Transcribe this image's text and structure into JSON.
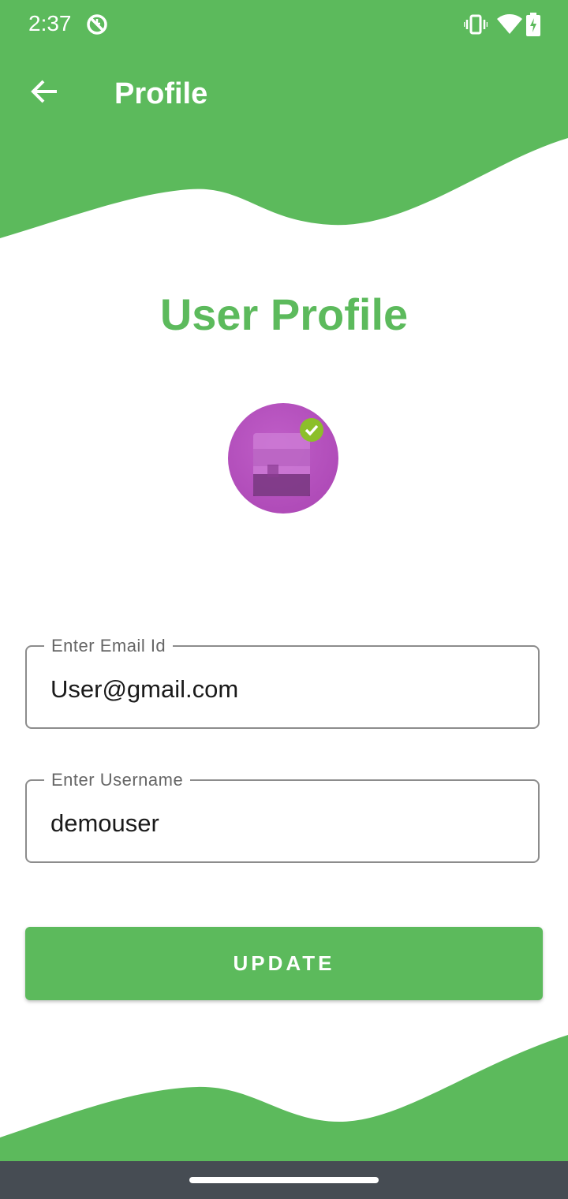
{
  "status_bar": {
    "time": "2:37",
    "icons": [
      "sync-off-icon",
      "vibrate-icon",
      "wifi-icon",
      "battery-charging-icon"
    ]
  },
  "app_bar": {
    "title": "Profile",
    "back_icon": "arrow-back-icon"
  },
  "page": {
    "heading": "User Profile",
    "avatar_icon": "puzzle-profile-icon"
  },
  "form": {
    "email": {
      "label": "Enter Email Id",
      "value": "User@gmail.com"
    },
    "username": {
      "label": "Enter Username",
      "value": "demouser"
    },
    "update_label": "UPDATE"
  },
  "colors": {
    "primary": "#5cba5c",
    "avatar": "#b24fbb",
    "nav_bar": "#464c53"
  }
}
